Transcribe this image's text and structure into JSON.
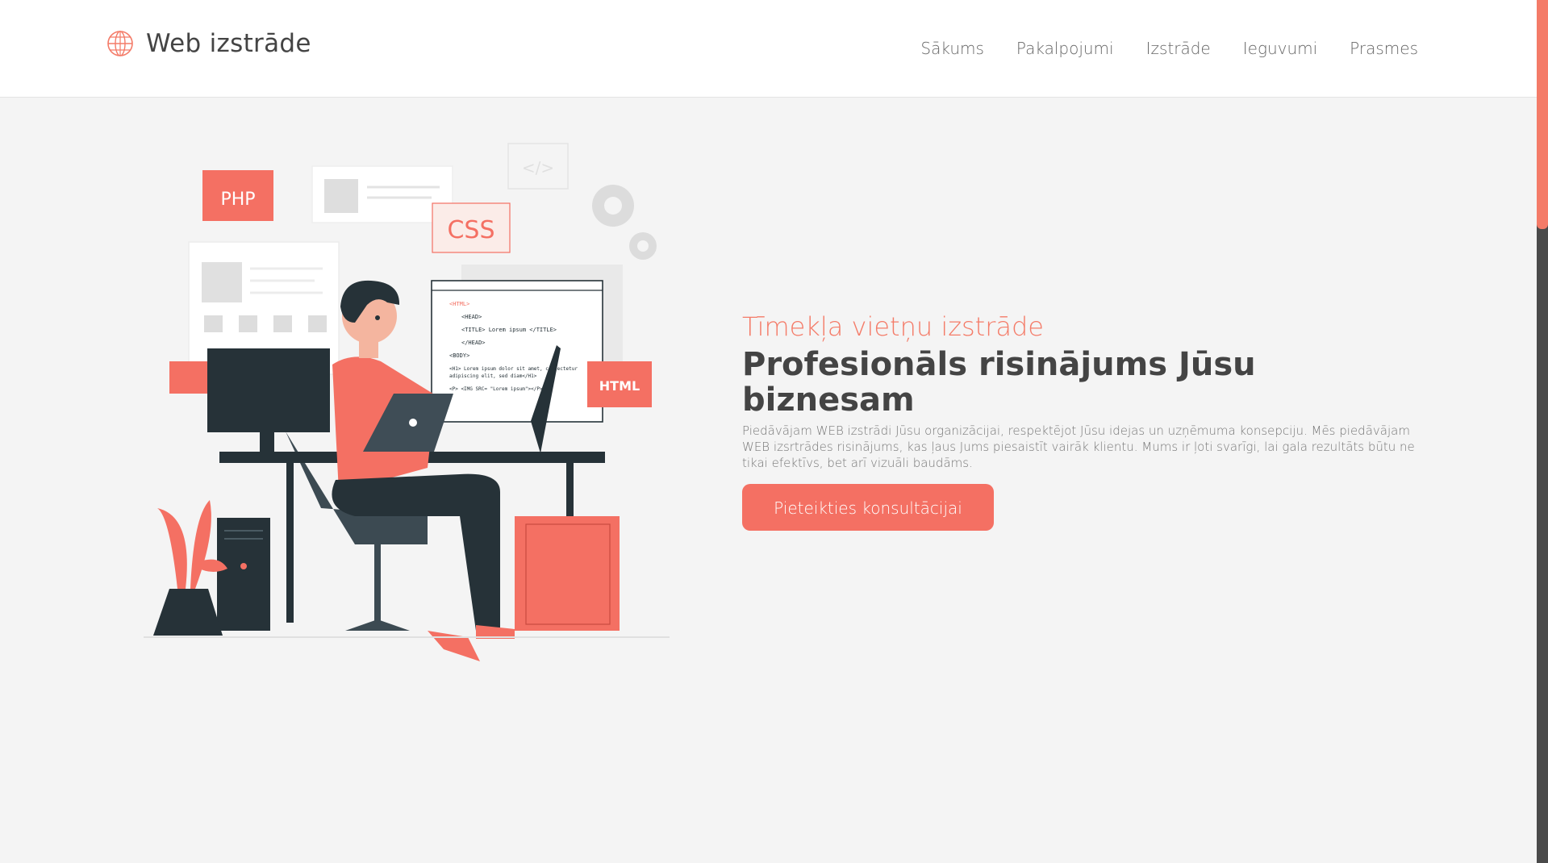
{
  "header": {
    "logo_text": "Web izstrāde",
    "logo_icon": "globe-icon",
    "nav": [
      "Sākums",
      "Pakalpojumi",
      "Izstrāde",
      "Ieguvumi",
      "Prasmes"
    ]
  },
  "hero": {
    "subtitle": "Tīmekļa vietņu izstrāde",
    "title": "Profesionāls risinājums Jūsu biznesam",
    "description": "Piedāvājam WEB izstrādi Jūsu organizācijai, respektējot Jūsu idejas un uzņēmuma konsepciju. Mēs piedāvājam WEB izsrtrādes risinājums, kas ļaus Jums piesaistīt vairāk klientu. Mums ir ļoti svarīgi, lai gala rezultāts būtu ne tikai efektīvs, bet arī vizuāli baudāms.",
    "cta_label": "Pieteikties konsultācijai"
  },
  "illustration": {
    "labels": {
      "php": "PHP",
      "css": "CSS",
      "html": "HTML",
      "code_lines": [
        "<HTML>",
        "<HEAD>",
        "<TITLE> Lorem ipsum </TITLE>",
        "</HEAD>",
        "<BODY>",
        "<H1> Lorem ipsum dolor sit amet, consectetur",
        "adipiscing elit, sed diam</H1>",
        "<P> <IMG SRC= \"Lorem ipsum\"></P>"
      ]
    }
  },
  "colors": {
    "accent": "#f47063",
    "text_dark": "#444444",
    "background": "#f4f4f4"
  }
}
